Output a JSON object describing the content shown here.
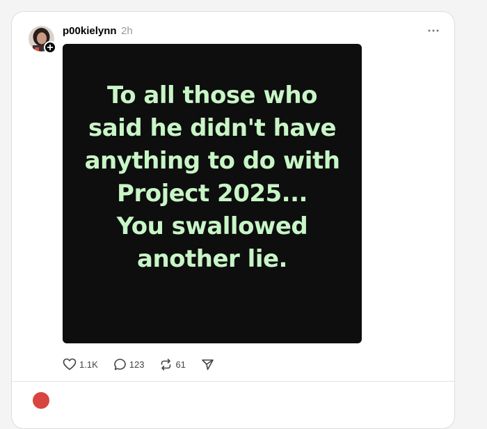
{
  "post": {
    "username": "p00kielynn",
    "time": "2h",
    "image_text": "To all those who\nsaid he didn't have\nanything to do with\nProject 2025...\nYou swallowed\nanother lie.",
    "likes": "1.1K",
    "replies": "123",
    "reposts": "61"
  },
  "icons": {
    "more": "more-horizontal-icon",
    "follow": "plus-icon",
    "like": "heart-icon",
    "reply": "comment-icon",
    "repost": "repost-icon",
    "share": "send-icon"
  },
  "colors": {
    "image_background": "#0e0e0e",
    "image_text": "#c8f5c6",
    "timestamp": "#9a9a9a"
  }
}
